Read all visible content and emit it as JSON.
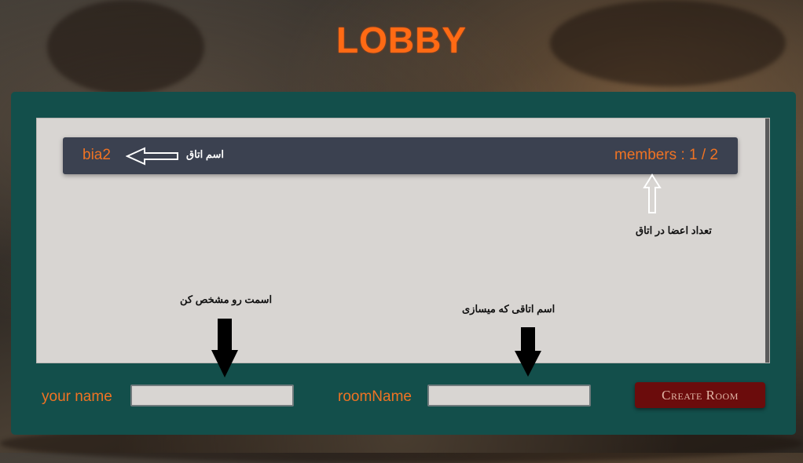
{
  "header": {
    "title": "LOBBY"
  },
  "rooms": [
    {
      "name": "bia2",
      "members": "members : 1 / 2"
    }
  ],
  "annotations": {
    "room_name_label": "اسم اتاق",
    "members_label": "تعداد اعضا در اتاق",
    "your_name_hint": "اسمت رو مشخص کن",
    "room_name_hint": "اسم اتاقی که میسازی"
  },
  "form": {
    "your_name_label": "your name",
    "your_name_value": "",
    "room_name_label": "roomName",
    "room_name_value": "",
    "create_button": "Create Room"
  },
  "colors": {
    "accent": "#f07323",
    "panel": "#134f4b",
    "room_item": "#3b4150",
    "button": "#6b0c0c"
  }
}
